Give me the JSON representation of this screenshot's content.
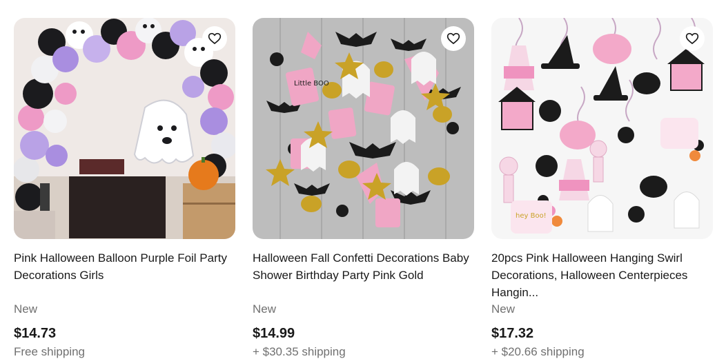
{
  "listings": [
    {
      "title": "Pink Halloween Balloon Purple Foil Party Decorations Girls",
      "condition": "New",
      "price": "$14.73",
      "shipping": "Free shipping",
      "image": "balloon-arch-photo",
      "favorite_icon": "heart-outline-icon"
    },
    {
      "title": "Halloween Fall Confetti Decorations Baby Shower Birthday Party Pink Gold",
      "condition": "New",
      "price": "$14.99",
      "shipping": "+ $30.35 shipping",
      "image": "confetti-photo",
      "favorite_icon": "heart-outline-icon"
    },
    {
      "title": "20pcs Pink Halloween Hanging Swirl Decorations, Halloween Centerpieces Hangin...",
      "condition": "New",
      "price": "$17.32",
      "shipping": "+ $20.66 shipping",
      "image": "hanging-swirl-photo",
      "favorite_icon": "heart-outline-icon"
    }
  ],
  "image_text": {
    "confetti_tag": "Little BOO",
    "swirl_tag": "hey Boo!"
  },
  "colors": {
    "text_primary": "#191919",
    "text_secondary": "#707070",
    "pink": "#f2a9c9",
    "purple": "#a78bd8",
    "gold": "#c9a227"
  }
}
